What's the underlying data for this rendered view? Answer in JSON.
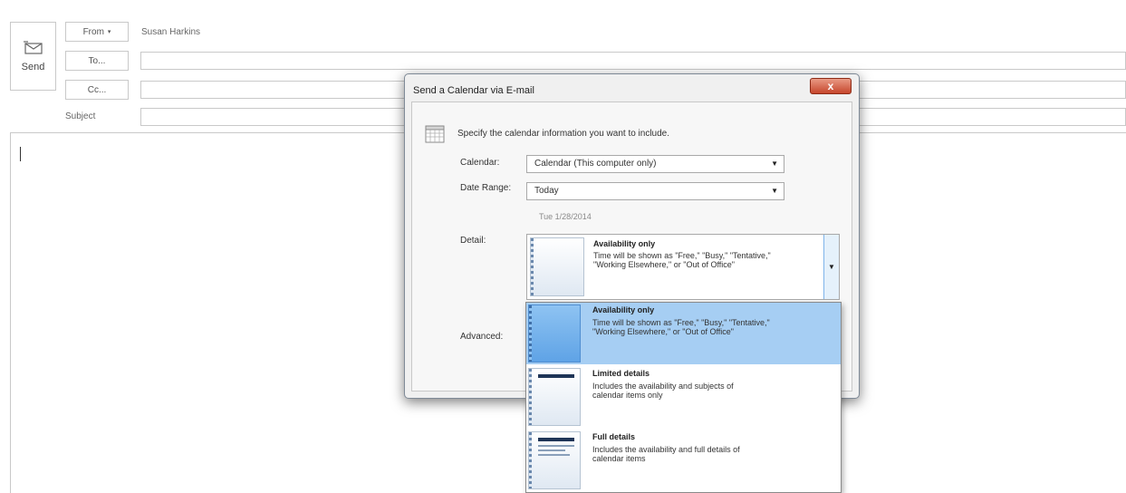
{
  "compose": {
    "send_label": "Send",
    "from_label": "From",
    "from_value": "Susan Harkins",
    "to_label": "To...",
    "cc_label": "Cc...",
    "subject_label": "Subject"
  },
  "dialog": {
    "title": "Send a Calendar via E-mail",
    "close_symbol": "x",
    "instruction": "Specify the calendar information you want to include.",
    "calendar_label": "Calendar:",
    "calendar_value": "Calendar (This computer only)",
    "date_range_label": "Date Range:",
    "date_range_value": "Today",
    "date_text": "Tue 1/28/2014",
    "detail_label": "Detail:",
    "advanced_label": "Advanced:",
    "detail_selected": {
      "title": "Availability only",
      "desc_line1": "Time will be shown as \"Free,\" \"Busy,\" \"Tentative,\"",
      "desc_line2": "\"Working Elsewhere,\" or \"Out of Office\""
    }
  },
  "detail_options": [
    {
      "title": "Availability only",
      "desc_line1": "Time will be shown as \"Free,\" \"Busy,\" \"Tentative,\"",
      "desc_line2": "\"Working Elsewhere,\" or \"Out of Office\"",
      "selected": true
    },
    {
      "title": "Limited details",
      "desc_line1": "Includes the availability and subjects of",
      "desc_line2": "calendar items only",
      "selected": false
    },
    {
      "title": "Full details",
      "desc_line1": "Includes the availability and full details of",
      "desc_line2": "calendar items",
      "selected": false
    }
  ],
  "colors": {
    "selection": "#a6cef3",
    "close_button": "#c6462c",
    "dropdown_button": "#e5f1fb"
  }
}
